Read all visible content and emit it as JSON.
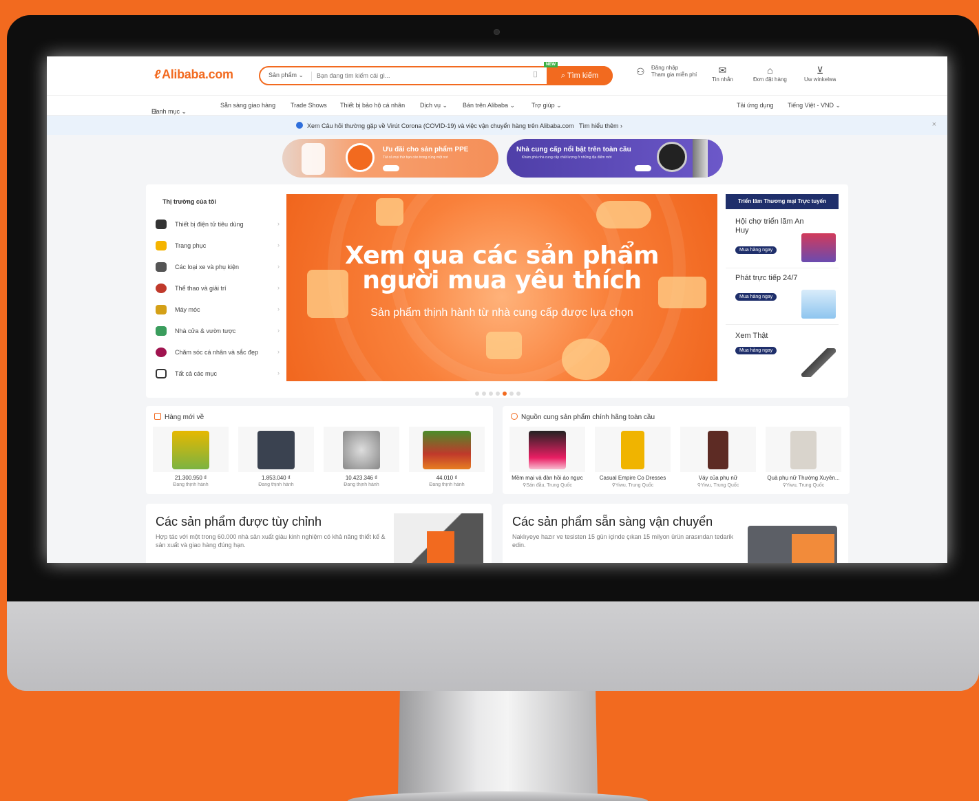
{
  "colors": {
    "brand": "#f26a1f",
    "navy": "#1f2f6b",
    "background": "#f26a1f"
  },
  "header": {
    "logo_text": "Alibaba.com",
    "search": {
      "category": "Sản phẩm ⌄",
      "placeholder": "Bạn đang tìm kiếm cái gì...",
      "button": "Tìm kiếm",
      "new_badge": "NEW"
    },
    "signin": {
      "line1": "Đăng nhập",
      "line2": "Tham gia miễn phí"
    },
    "messages": "Tin nhắn",
    "orders": "Đơn đặt hàng",
    "cart": "Uw winkelwa"
  },
  "nav": {
    "categories": "Danh mục ⌄",
    "items": [
      "Sẵn sàng giao hàng",
      "Trade Shows",
      "Thiết bị bảo hộ cá nhân",
      "Dịch vụ ⌄",
      "Bán trên Alibaba ⌄",
      "Trợ giúp ⌄"
    ],
    "get_app": "Tải ứng dụng",
    "language": "Tiếng Việt - VND ⌄"
  },
  "notice": {
    "text": "Xem Câu hỏi thường gặp về Virút Corona (COVID-19) và việc vận chuyển hàng trên Alibaba.com",
    "link": "Tìm hiểu thêm ›",
    "close": "×"
  },
  "promos": [
    {
      "title": "Ưu đãi cho sản phẩm PPE",
      "subtitle": "Tất cả mọi thứ bạn cần trong cùng một nơi"
    },
    {
      "title": "Nhà cung cấp nổi bật trên toàn cầu",
      "subtitle": "Khám phá nhà cung cấp chất lượng ở những địa điểm mới"
    }
  ],
  "my_market": {
    "title": "Thị trường của tôi",
    "categories": [
      {
        "label": "Thiết bị điện tử tiêu dùng",
        "icon": "camera-icon"
      },
      {
        "label": "Trang phục",
        "icon": "shirt-icon"
      },
      {
        "label": "Các loại xe và phụ kiện",
        "icon": "car-icon"
      },
      {
        "label": "Thể thao và giải trí",
        "icon": "ball-icon"
      },
      {
        "label": "Máy móc",
        "icon": "machine-icon"
      },
      {
        "label": "Nhà cửa & vườn tược",
        "icon": "plant-icon"
      },
      {
        "label": "Chăm sóc cá nhân và sắc đẹp",
        "icon": "cosmetics-icon"
      },
      {
        "label": "Tất cả các mục",
        "icon": "grid-icon"
      }
    ]
  },
  "hero": {
    "line1": "Xem qua các sản phẩm",
    "line2": "người mua yêu thích",
    "subtitle": "Sản phẩm thịnh hành từ nhà cung cấp được lựa chọn"
  },
  "expo": {
    "header": "Triển lãm Thương mại Trực tuyến",
    "items": [
      {
        "title": "Hội chợ triển lãm An Huy",
        "button": "Mua hàng ngay"
      },
      {
        "title": "Phát trực tiếp 24/7",
        "button": "Mua hàng ngay"
      },
      {
        "title": "Xem Thật",
        "button": "Mua hàng ngay"
      }
    ]
  },
  "new_arrivals": {
    "title": "Hàng mới về",
    "items": [
      {
        "price": "21.300.950 ₫",
        "status": "Đang thịnh hành"
      },
      {
        "price": "1.853.040 ₫",
        "status": "Đang thịnh hành"
      },
      {
        "price": "10.423.346 ₫",
        "status": "Đang thịnh hành"
      },
      {
        "price": "44.010 ₫",
        "status": "Đang thịnh hành"
      }
    ]
  },
  "global_sources": {
    "title": "Nguồn cung sản phẩm chính hãng toàn cầu",
    "items": [
      {
        "name": "Mềm mại và đàn hồi áo ngực",
        "location": "Sán đầu, Trung Quốc"
      },
      {
        "name": "Casual Empire Co Dresses",
        "location": "Yiwu, Trung Quốc"
      },
      {
        "name": "Váy của phụ nữ",
        "location": "Yiwu, Trung Quốc"
      },
      {
        "name": "Quà phụ nữ Thường Xuyên...",
        "location": "Yiwu, Trung Quốc"
      }
    ]
  },
  "features": [
    {
      "title": "Các sản phẩm được tùy chỉnh",
      "desc": "Hợp tác với một trong 60.000 nhà sản xuất giàu kinh nghiệm có khả năng thiết kế & sản xuất và giao hàng đúng hạn."
    },
    {
      "title": "Các sản phẩm sẵn sàng vận chuyển",
      "desc": "Naklıyeye hazır ve tesisten 15 gün içinde çıkan 15 milyon ürün arasından tedarik edin."
    }
  ]
}
